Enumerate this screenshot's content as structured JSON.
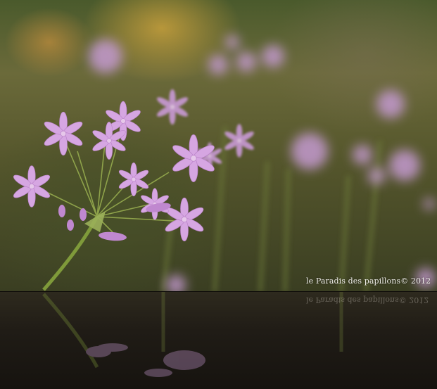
{
  "watermark": {
    "text": "le Paradis des papillons© 2012"
  }
}
